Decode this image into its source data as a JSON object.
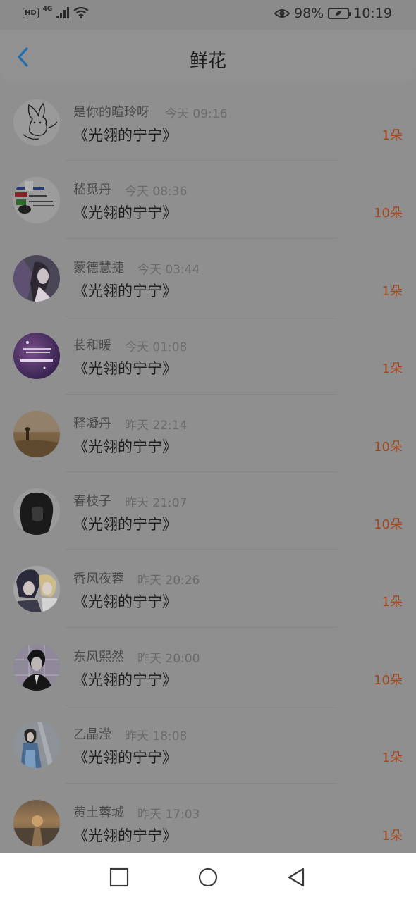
{
  "status": {
    "hd": "HD",
    "network": "4G",
    "battery": "98%",
    "time": "10:19"
  },
  "header": {
    "title": "鲜花"
  },
  "colors": {
    "overlay_bg": "#8f8f8f",
    "accent_blue": "#1f6fb0",
    "count_color": "#a4461a"
  },
  "gifts": [
    {
      "name": "是你的暄玲呀",
      "time": "今天 09:16",
      "book": "《光翎的宁宁》",
      "count": "1朵",
      "avatar": "rabbit-sketch"
    },
    {
      "name": "嵇觅丹",
      "time": "今天 08:36",
      "book": "《光翎的宁宁》",
      "count": "10朵",
      "avatar": "paint-strokes"
    },
    {
      "name": "蒙德慧捷",
      "time": "今天 03:44",
      "book": "《光翎的宁宁》",
      "count": "1朵",
      "avatar": "anime-dark"
    },
    {
      "name": "苌和暖",
      "time": "今天 01:08",
      "book": "《光翎的宁宁》",
      "count": "1朵",
      "avatar": "purple-text"
    },
    {
      "name": "释凝丹",
      "time": "昨天 22:14",
      "book": "《光翎的宁宁》",
      "count": "10朵",
      "avatar": "desert-figure"
    },
    {
      "name": "春枝子",
      "time": "昨天 21:07",
      "book": "《光翎的宁宁》",
      "count": "10朵",
      "avatar": "dark-hair"
    },
    {
      "name": "香风夜蓉",
      "time": "昨天 20:26",
      "book": "《光翎的宁宁》",
      "count": "1朵",
      "avatar": "anime-couple"
    },
    {
      "name": "东风熙然",
      "time": "昨天 20:00",
      "book": "《光翎的宁宁》",
      "count": "10朵",
      "avatar": "man-suit"
    },
    {
      "name": "乙晶滢",
      "time": "昨天 18:08",
      "book": "《光翎的宁宁》",
      "count": "1朵",
      "avatar": "girl-blue"
    },
    {
      "name": "黄土蓉城",
      "time": "昨天 17:03",
      "book": "《光翎的宁宁》",
      "count": "1朵",
      "avatar": "sunset-sea"
    }
  ]
}
